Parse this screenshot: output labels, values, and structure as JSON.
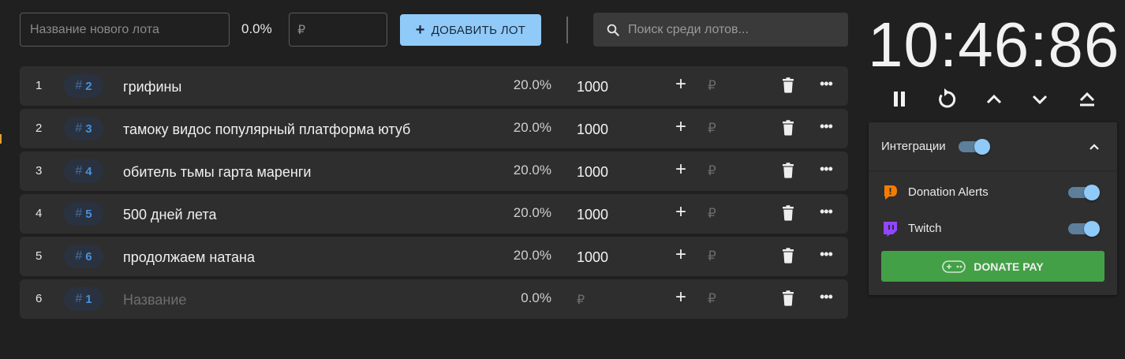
{
  "new_lot": {
    "name_placeholder": "Название нового лота",
    "percent": "0.0%",
    "currency_symbol": "₽",
    "add_button_label": "ДОБАВИТЬ ЛОТ"
  },
  "search": {
    "placeholder": "Поиск среди лотов..."
  },
  "lots": [
    {
      "index": "1",
      "tag": "2",
      "name": "грифины",
      "percent": "20.0%",
      "amount": "1000"
    },
    {
      "index": "2",
      "tag": "3",
      "name": "тамоку видос популярный платформа ютуб",
      "percent": "20.0%",
      "amount": "1000"
    },
    {
      "index": "3",
      "tag": "4",
      "name": "обитель тьмы гарта маренги",
      "percent": "20.0%",
      "amount": "1000"
    },
    {
      "index": "4",
      "tag": "5",
      "name": "500 дней лета",
      "percent": "20.0%",
      "amount": "1000"
    },
    {
      "index": "5",
      "tag": "6",
      "name": "продолжаем натана",
      "percent": "20.0%",
      "amount": "1000"
    },
    {
      "index": "6",
      "tag": "1",
      "name_placeholder": "Название",
      "percent": "0.0%",
      "amount_placeholder": "₽"
    }
  ],
  "row_actions": {
    "add_glyph": "+",
    "currency_glyph": "₽",
    "more_glyph": "•••",
    "tag_hash": "#"
  },
  "timer": {
    "display": "10:46:86"
  },
  "integrations": {
    "title": "Интеграции",
    "enabled": true,
    "services": [
      {
        "label": "Donation Alerts",
        "enabled": true,
        "icon": "donation-alerts-icon",
        "color": "#f57c00"
      },
      {
        "label": "Twitch",
        "enabled": true,
        "icon": "twitch-icon",
        "color": "#9146ff"
      }
    ],
    "donate_pay_label": "DONATE PAY"
  },
  "colors": {
    "accent": "#90caf9",
    "donate_pay": "#43a047",
    "tag_text": "#4a90d9"
  }
}
